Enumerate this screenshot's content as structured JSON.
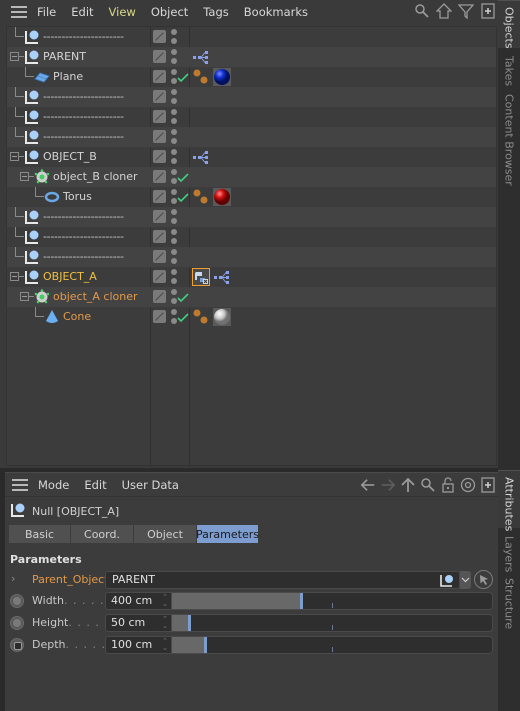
{
  "objects_panel": {
    "menu": [
      {
        "label": "File",
        "active": false
      },
      {
        "label": "Edit",
        "active": false
      },
      {
        "label": "View",
        "active": true
      },
      {
        "label": "Object",
        "active": false
      },
      {
        "label": "Tags",
        "active": false
      },
      {
        "label": "Bookmarks",
        "active": false
      }
    ],
    "toolbar_icons": [
      "search-icon",
      "home-icon",
      "filter-icon",
      "new-window-icon"
    ],
    "rows": [
      {
        "name": "----------------------",
        "type": "null",
        "depth": 1,
        "expander": false,
        "style": "dashes",
        "check": false,
        "tags": []
      },
      {
        "name": "PARENT",
        "type": "null",
        "depth": 1,
        "expander": true,
        "style": "normal",
        "check": false,
        "tags": [
          "hierarchy-tag"
        ]
      },
      {
        "name": "Plane",
        "type": "plane",
        "depth": 2,
        "expander": false,
        "style": "normal",
        "check": true,
        "tags": [
          "phong-tag",
          "material-blue"
        ]
      },
      {
        "name": "----------------------",
        "type": "null",
        "depth": 1,
        "expander": false,
        "style": "dashes",
        "check": false,
        "tags": []
      },
      {
        "name": "----------------------",
        "type": "null",
        "depth": 1,
        "expander": false,
        "style": "dashes",
        "check": false,
        "tags": []
      },
      {
        "name": "----------------------",
        "type": "null",
        "depth": 1,
        "expander": false,
        "style": "dashes",
        "check": false,
        "tags": []
      },
      {
        "name": "OBJECT_B",
        "type": "null",
        "depth": 1,
        "expander": true,
        "style": "normal",
        "check": false,
        "tags": [
          "hierarchy-tag"
        ]
      },
      {
        "name": "object_B cloner",
        "type": "cloner",
        "depth": 2,
        "expander": true,
        "style": "normal",
        "check": true,
        "tags": []
      },
      {
        "name": "Torus",
        "type": "torus",
        "depth": 3,
        "expander": false,
        "style": "normal",
        "check": true,
        "tags": [
          "phong-tag",
          "material-red"
        ]
      },
      {
        "name": "----------------------",
        "type": "null",
        "depth": 1,
        "expander": false,
        "style": "dashes",
        "check": false,
        "tags": []
      },
      {
        "name": "----------------------",
        "type": "null",
        "depth": 1,
        "expander": false,
        "style": "dashes",
        "check": false,
        "tags": []
      },
      {
        "name": "----------------------",
        "type": "null",
        "depth": 1,
        "expander": false,
        "style": "dashes",
        "check": false,
        "tags": []
      },
      {
        "name": "OBJECT_A",
        "type": "null",
        "depth": 1,
        "expander": true,
        "style": "yellow",
        "check": false,
        "tags": [
          "python-tag-selected",
          "hierarchy-tag"
        ]
      },
      {
        "name": "object_A cloner",
        "type": "cloner",
        "depth": 2,
        "expander": true,
        "style": "orange",
        "check": true,
        "tags": []
      },
      {
        "name": "Cone",
        "type": "cone",
        "depth": 3,
        "expander": false,
        "style": "orange",
        "check": true,
        "tags": [
          "phong-tag",
          "material-white"
        ]
      }
    ]
  },
  "side_tabs_top": [
    {
      "label": "Objects",
      "active": true
    },
    {
      "label": "Takes",
      "active": false
    },
    {
      "label": "Content Browser",
      "active": false
    }
  ],
  "side_tabs_bottom": [
    {
      "label": "Attributes",
      "active": true
    },
    {
      "label": "Layers",
      "active": false
    },
    {
      "label": "Structure",
      "active": false
    }
  ],
  "attributes_panel": {
    "menu": [
      "Mode",
      "Edit",
      "User Data"
    ],
    "toolbar_icons": [
      "back-arrow-icon",
      "forward-arrow-icon",
      "up-arrow-icon",
      "search-icon",
      "lock-icon",
      "target-icon",
      "new-window-icon"
    ],
    "object_title": "Null [OBJECT_A]",
    "tabs": [
      {
        "label": "Basic",
        "active": false
      },
      {
        "label": "Coord.",
        "active": false
      },
      {
        "label": "Object",
        "active": false
      },
      {
        "label": "Parameters",
        "active": true
      }
    ],
    "section_title": "Parameters",
    "parent_object": {
      "label": "Parent_Object",
      "value": "PARENT"
    },
    "params": [
      {
        "label": "Width",
        "dots": ". . . . .",
        "value": "400 cm",
        "slider_fraction": 0.4
      },
      {
        "label": "Height",
        "dots": ". . . .",
        "value": "50 cm",
        "slider_fraction": 0.05
      },
      {
        "label": "Depth",
        "dots": ". . . . .",
        "value": "100 cm",
        "slider_fraction": 0.1
      }
    ]
  },
  "colors": {
    "accent_blue": "#7d9cd0",
    "selected_orange": "#e39a4a",
    "selected_yellow": "#f0c040",
    "check_green": "#3fcf7f"
  }
}
